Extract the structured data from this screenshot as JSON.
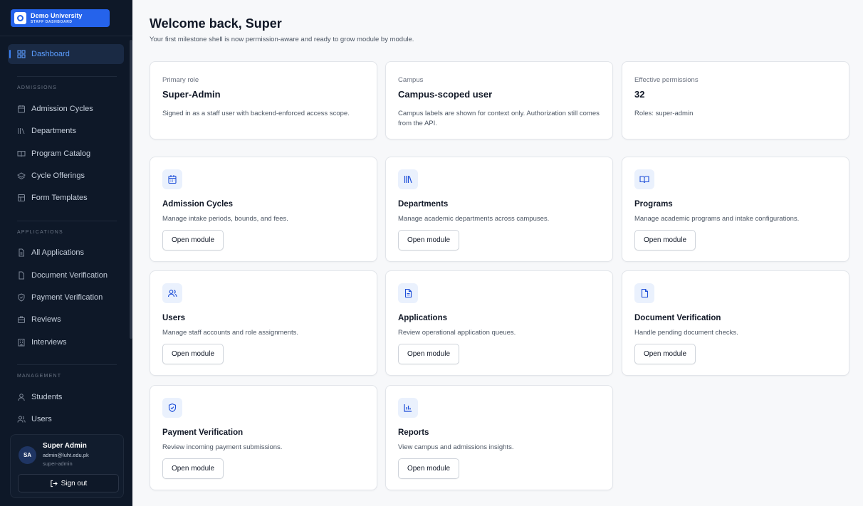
{
  "brand": {
    "title": "Demo University",
    "subtitle": "STAFF DASHBOARD",
    "accent": "#2563eb"
  },
  "sidebar": {
    "active": {
      "label": "Dashboard",
      "icon": "dashboard-grid-icon"
    },
    "sections": [
      {
        "label": "ADMISSIONS",
        "items": [
          {
            "label": "Admission Cycles",
            "icon": "calendar-icon"
          },
          {
            "label": "Departments",
            "icon": "library-icon"
          },
          {
            "label": "Program Catalog",
            "icon": "book-open-icon"
          },
          {
            "label": "Cycle Offerings",
            "icon": "layers-icon"
          },
          {
            "label": "Form Templates",
            "icon": "form-template-icon"
          }
        ]
      },
      {
        "label": "APPLICATIONS",
        "items": [
          {
            "label": "All Applications",
            "icon": "file-text-icon"
          },
          {
            "label": "Document Verification",
            "icon": "file-check-icon"
          },
          {
            "label": "Payment Verification",
            "icon": "shield-check-icon"
          },
          {
            "label": "Reviews",
            "icon": "briefcase-icon"
          },
          {
            "label": "Interviews",
            "icon": "building-icon"
          }
        ]
      },
      {
        "label": "MANAGEMENT",
        "items": [
          {
            "label": "Students",
            "icon": "user-icon"
          },
          {
            "label": "Users",
            "icon": "users-icon"
          }
        ]
      }
    ]
  },
  "user": {
    "initials": "SA",
    "name": "Super Admin",
    "email": "admin@luht.edu.pk",
    "role": "super-admin",
    "signout_label": "Sign out"
  },
  "header": {
    "title": "Welcome back, Super",
    "subtitle": "Your first milestone shell is now permission-aware and ready to grow module by module."
  },
  "stats": [
    {
      "label": "Primary role",
      "value": "Super-Admin",
      "desc": "Signed in as a staff user with backend-enforced access scope."
    },
    {
      "label": "Campus",
      "value": "Campus-scoped user",
      "desc": "Campus labels are shown for context only. Authorization still comes from the API."
    },
    {
      "label": "Effective permissions",
      "value": "32",
      "desc": "Roles: super-admin"
    }
  ],
  "modules": [
    {
      "title": "Admission Cycles",
      "desc": "Manage intake periods, bounds, and fees.",
      "icon": "calendar-icon",
      "button": "Open module"
    },
    {
      "title": "Departments",
      "desc": "Manage academic departments across campuses.",
      "icon": "library-icon",
      "button": "Open module"
    },
    {
      "title": "Programs",
      "desc": "Manage academic programs and intake configurations.",
      "icon": "book-open-icon",
      "button": "Open module"
    },
    {
      "title": "Users",
      "desc": "Manage staff accounts and role assignments.",
      "icon": "users-icon",
      "button": "Open module"
    },
    {
      "title": "Applications",
      "desc": "Review operational application queues.",
      "icon": "file-text-icon",
      "button": "Open module"
    },
    {
      "title": "Document Verification",
      "desc": "Handle pending document checks.",
      "icon": "file-check-icon",
      "button": "Open module"
    },
    {
      "title": "Payment Verification",
      "desc": "Review incoming payment submissions.",
      "icon": "shield-check-icon",
      "button": "Open module"
    },
    {
      "title": "Reports",
      "desc": "View campus and admissions insights.",
      "icon": "bar-chart-icon",
      "button": "Open module"
    }
  ]
}
